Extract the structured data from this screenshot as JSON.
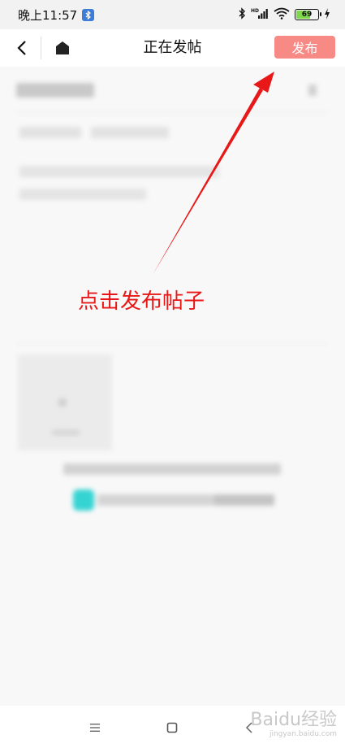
{
  "status_bar": {
    "time": "晚上11:57",
    "battery_level": "69",
    "icons": [
      "bluetooth-icon",
      "hd-signal-icon",
      "wifi-icon",
      "battery-icon",
      "charging-icon"
    ]
  },
  "nav": {
    "title": "正在发帖",
    "publish_label": "发布",
    "publish_color": "#f88a86",
    "icons": [
      "back-arrow-icon",
      "home-icon"
    ]
  },
  "annotation": {
    "text": "点击发布帖子",
    "color": "#e81818"
  },
  "bottom_nav": {
    "icons": [
      "menu-icon",
      "home-square-icon",
      "back-chevron-icon"
    ]
  },
  "watermark": {
    "text": "Baidu经验",
    "subtext": "jingyan.baidu.com"
  },
  "colors": {
    "accent_teal": "#36d3d3",
    "page_bg": "#f8f8f8"
  }
}
